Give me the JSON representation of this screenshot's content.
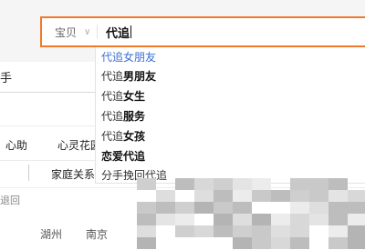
{
  "search": {
    "scope_label": "宝贝",
    "scope_chevron": "∨",
    "query": "代追"
  },
  "suggestions": [
    {
      "prefix": "代追",
      "rest": "女朋友",
      "highlighted": true
    },
    {
      "prefix": "代追",
      "rest": "男朋友",
      "highlighted": false
    },
    {
      "prefix": "代追",
      "rest": "女生",
      "highlighted": false
    },
    {
      "prefix": "代追",
      "rest": "服务",
      "highlighted": false
    },
    {
      "prefix": "代追",
      "rest": "女孩",
      "highlighted": false
    },
    {
      "prefix": "",
      "rest": "恋爱代追",
      "highlighted": false
    },
    {
      "prefix": "",
      "rest": "分手挽回代追",
      "highlighted": false
    }
  ],
  "page": {
    "side_title": "手",
    "cat_1": "心助",
    "cat_2": "心灵花园",
    "cat_3": "家庭关系咨询",
    "fragment": "退回",
    "city_1": "湖州",
    "city_2": "南京"
  },
  "colors": {
    "accent": "#f07a2a",
    "highlight_text": "#3a6fd8"
  }
}
